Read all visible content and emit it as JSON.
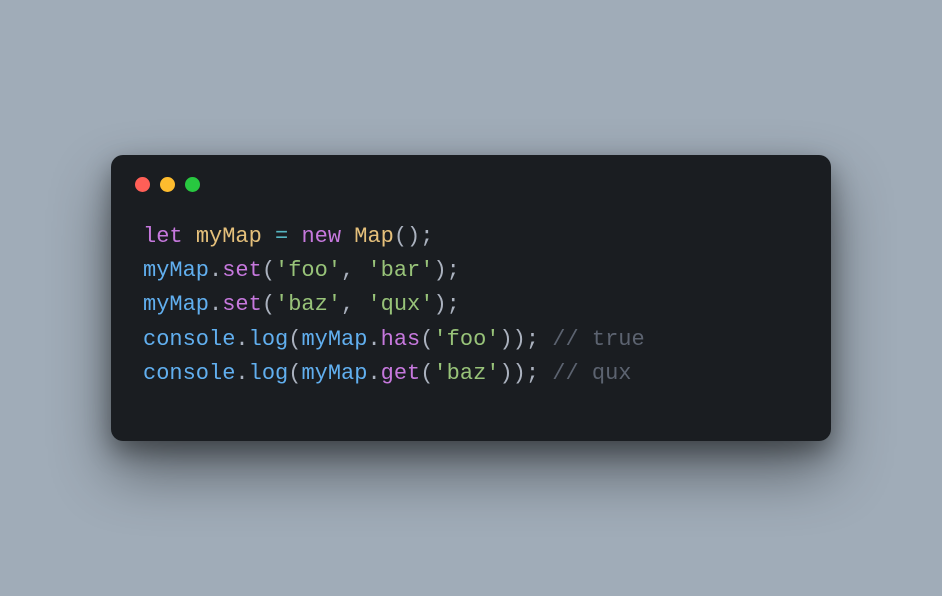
{
  "colors": {
    "background": "#a0acb8",
    "window": "#1a1d21",
    "dot_red": "#ff5f57",
    "dot_yellow": "#febc2e",
    "dot_green": "#28c840",
    "keyword": "#c678dd",
    "class": "#e5c07b",
    "variable": "#61afef",
    "operator": "#56b6c2",
    "punct": "#abb2bf",
    "string": "#98c379",
    "comment": "#5c6370"
  },
  "code": {
    "language": "javascript",
    "plain": "let myMap = new Map();\nmyMap.set('foo', 'bar');\nmyMap.set('baz', 'qux');\nconsole.log(myMap.has('foo')); // true\nconsole.log(myMap.get('baz')); // qux",
    "lines": [
      [
        {
          "t": "let ",
          "c": "keyword"
        },
        {
          "t": "myMap ",
          "c": "def"
        },
        {
          "t": "= ",
          "c": "op"
        },
        {
          "t": "new ",
          "c": "new"
        },
        {
          "t": "Map",
          "c": "class"
        },
        {
          "t": "();",
          "c": "punct"
        }
      ],
      [
        {
          "t": "myMap",
          "c": "var"
        },
        {
          "t": ".",
          "c": "punct"
        },
        {
          "t": "set",
          "c": "method"
        },
        {
          "t": "(",
          "c": "punct"
        },
        {
          "t": "'foo'",
          "c": "str"
        },
        {
          "t": ", ",
          "c": "punct"
        },
        {
          "t": "'bar'",
          "c": "str"
        },
        {
          "t": ");",
          "c": "punct"
        }
      ],
      [
        {
          "t": "myMap",
          "c": "var"
        },
        {
          "t": ".",
          "c": "punct"
        },
        {
          "t": "set",
          "c": "method"
        },
        {
          "t": "(",
          "c": "punct"
        },
        {
          "t": "'baz'",
          "c": "str"
        },
        {
          "t": ", ",
          "c": "punct"
        },
        {
          "t": "'qux'",
          "c": "str"
        },
        {
          "t": ");",
          "c": "punct"
        }
      ],
      [
        {
          "t": "console",
          "c": "obj"
        },
        {
          "t": ".",
          "c": "punct"
        },
        {
          "t": "log",
          "c": "call"
        },
        {
          "t": "(",
          "c": "punct"
        },
        {
          "t": "myMap",
          "c": "var"
        },
        {
          "t": ".",
          "c": "punct"
        },
        {
          "t": "has",
          "c": "method"
        },
        {
          "t": "(",
          "c": "punct"
        },
        {
          "t": "'foo'",
          "c": "str"
        },
        {
          "t": ")); ",
          "c": "punct"
        },
        {
          "t": "// true",
          "c": "comment"
        }
      ],
      [
        {
          "t": "console",
          "c": "obj"
        },
        {
          "t": ".",
          "c": "punct"
        },
        {
          "t": "log",
          "c": "call"
        },
        {
          "t": "(",
          "c": "punct"
        },
        {
          "t": "myMap",
          "c": "var"
        },
        {
          "t": ".",
          "c": "punct"
        },
        {
          "t": "get",
          "c": "method"
        },
        {
          "t": "(",
          "c": "punct"
        },
        {
          "t": "'baz'",
          "c": "str"
        },
        {
          "t": ")); ",
          "c": "punct"
        },
        {
          "t": "// qux",
          "c": "comment"
        }
      ]
    ]
  }
}
